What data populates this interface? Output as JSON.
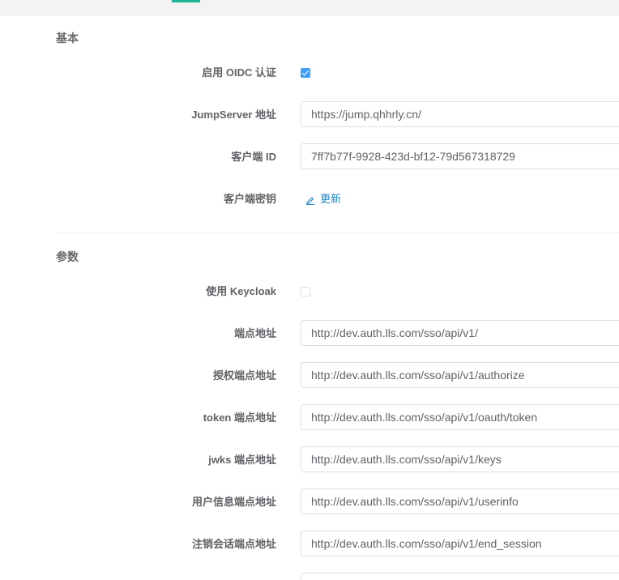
{
  "sections": {
    "basic": {
      "title": "基本"
    },
    "params": {
      "title": "参数"
    }
  },
  "basic_fields": {
    "enable_oidc": {
      "label": "启用 OIDC 认证",
      "checked": true
    },
    "jumpserver_url": {
      "label": "JumpServer 地址",
      "value": "https://jump.qhhrly.cn/"
    },
    "client_id": {
      "label": "客户端 ID",
      "value": "7ff7b77f-9928-423d-bf12-79d567318729"
    },
    "client_secret": {
      "label": "客户端密钥",
      "action": "更新"
    }
  },
  "param_fields": {
    "use_keycloak": {
      "label": "使用 Keycloak",
      "checked": false
    },
    "endpoint": {
      "label": "端点地址",
      "value": "http://dev.auth.lls.com/sso/api/v1/"
    },
    "authorize_endpoint": {
      "label": "授权端点地址",
      "value": "http://dev.auth.lls.com/sso/api/v1/authorize"
    },
    "token_endpoint": {
      "label": "token 端点地址",
      "value": "http://dev.auth.lls.com/sso/api/v1/oauth/token"
    },
    "jwks_endpoint": {
      "label": "jwks 端点地址",
      "value": "http://dev.auth.lls.com/sso/api/v1/keys"
    },
    "userinfo_endpoint": {
      "label": "用户信息端点地址",
      "value": "http://dev.auth.lls.com/sso/api/v1/userinfo"
    },
    "end_session_endpoint": {
      "label": "注销会话端点地址",
      "value": "http://dev.auth.lls.com/sso/api/v1/end_session"
    }
  },
  "colors": {
    "accent": "#1ab394",
    "checkbox_checked": "#409eff",
    "link": "#1c84c6"
  }
}
